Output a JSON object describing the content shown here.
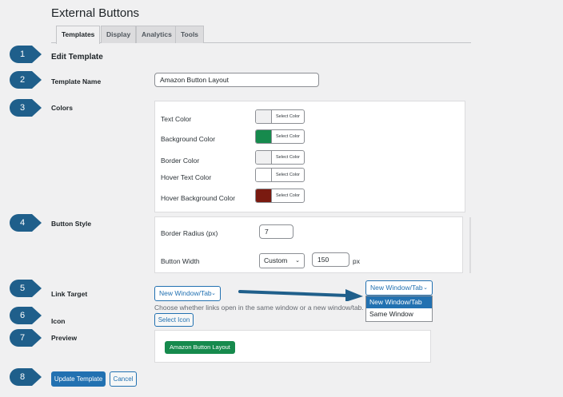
{
  "page": {
    "title": "External Buttons"
  },
  "tabs": [
    {
      "label": "Templates",
      "active": true
    },
    {
      "label": "Display",
      "active": false
    },
    {
      "label": "Analytics",
      "active": false
    },
    {
      "label": "Tools",
      "active": false
    }
  ],
  "section_title": "Edit Template",
  "fields": {
    "template_name": {
      "label": "Template Name",
      "value": "Amazon Button Layout"
    },
    "colors": {
      "label": "Colors",
      "items": [
        {
          "label": "Text Color",
          "button": "Select Color",
          "color": "#f0f0f1"
        },
        {
          "label": "Background Color",
          "button": "Select Color",
          "color": "#168a4d"
        },
        {
          "label": "Border Color",
          "button": "Select Color",
          "color": "#f0f0f1"
        },
        {
          "label": "Hover Text Color",
          "button": "Select Color",
          "color": "#ffffff"
        },
        {
          "label": "Hover Background Color",
          "button": "Select Color",
          "color": "#7a1a10"
        }
      ]
    },
    "button_style": {
      "label": "Button Style",
      "border_radius_label": "Border Radius (px)",
      "border_radius_value": "7",
      "button_width_label": "Button Width",
      "button_width_mode": "Custom",
      "button_width_value": "150",
      "button_width_unit": "px"
    },
    "link_target": {
      "label": "Link Target",
      "value": "New Window/Tab",
      "help": "Choose whether links open in the same window or a new window/tab.",
      "options": [
        "New Window/Tab",
        "Same Window"
      ]
    },
    "icon": {
      "label": "Icon",
      "button": "Select Icon"
    },
    "preview": {
      "label": "Preview",
      "button_text": "Amazon Button Layout"
    }
  },
  "actions": {
    "update": "Update Template",
    "cancel": "Cancel"
  },
  "callouts": [
    "1",
    "2",
    "3",
    "4",
    "5",
    "6",
    "7",
    "8"
  ],
  "colors": {
    "primary": "#2271b1",
    "callout": "#1f5f8b",
    "preview_bg": "#168a4d"
  }
}
